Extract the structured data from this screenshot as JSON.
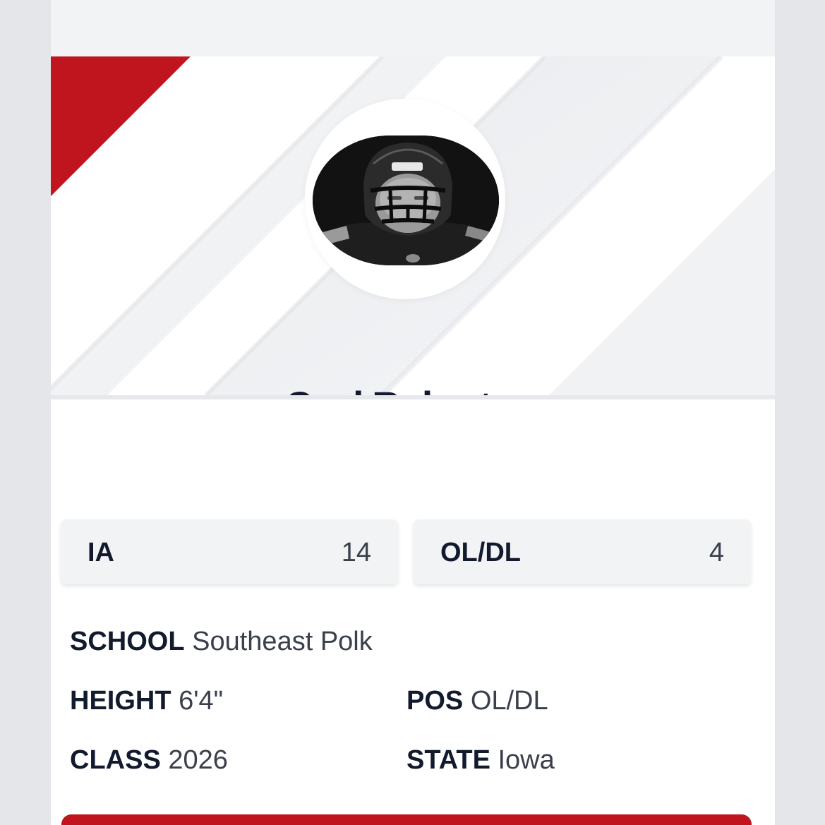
{
  "player": {
    "name": "Cael Roberts",
    "photo": "player-helmet-photo"
  },
  "rankings": [
    {
      "label": "IA",
      "value": "14"
    },
    {
      "label": "OL/DL",
      "value": "4"
    }
  ],
  "details": {
    "school": {
      "key": "SCHOOL",
      "value": "Southeast Polk"
    },
    "height": {
      "key": "HEIGHT",
      "value": "6'4\""
    },
    "pos": {
      "key": "POS",
      "value": "OL/DL"
    },
    "class": {
      "key": "CLASS",
      "value": "2026"
    },
    "state": {
      "key": "STATE",
      "value": "Iowa"
    }
  },
  "colors": {
    "accent": "#c0151f",
    "text_dark": "#121a2e",
    "text_muted": "#3a3f4c",
    "panel": "#f2f3f5",
    "page_bg": "#e4e6ea"
  }
}
